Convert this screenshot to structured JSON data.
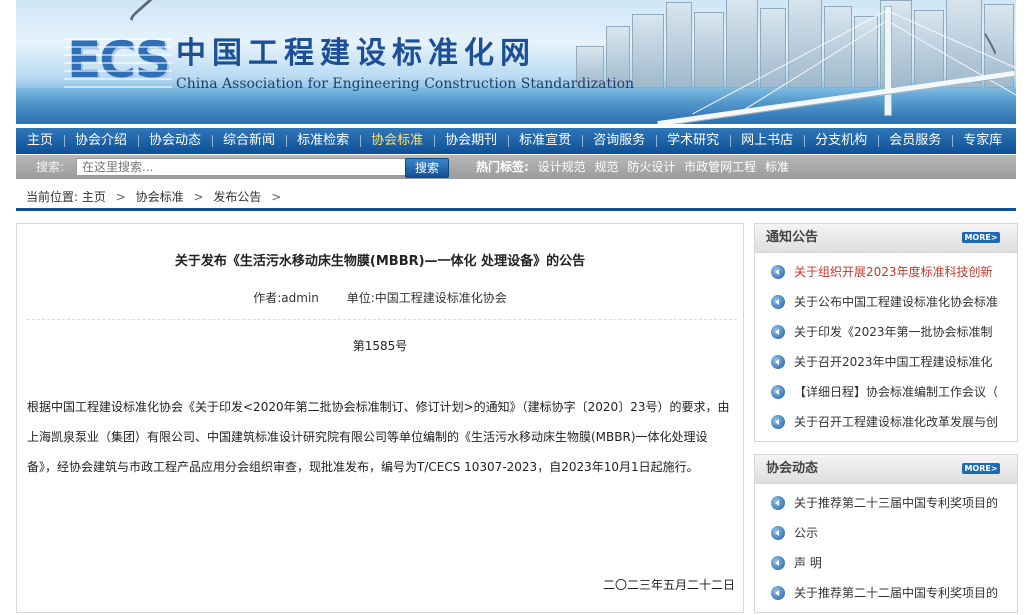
{
  "header": {
    "logo_letters": "ECS",
    "site_name_cn": "中国工程建设标准化网",
    "site_name_en": "China Association for Engineering Construction Standardization"
  },
  "nav": [
    {
      "label": "主页",
      "active": false
    },
    {
      "label": "协会介绍",
      "active": false
    },
    {
      "label": "协会动态",
      "active": false
    },
    {
      "label": "综合新闻",
      "active": false
    },
    {
      "label": "标准检索",
      "active": false
    },
    {
      "label": "协会标准",
      "active": true
    },
    {
      "label": "协会期刊",
      "active": false
    },
    {
      "label": "标准宣贯",
      "active": false
    },
    {
      "label": "咨询服务",
      "active": false
    },
    {
      "label": "学术研究",
      "active": false
    },
    {
      "label": "网上书店",
      "active": false
    },
    {
      "label": "分支机构",
      "active": false
    },
    {
      "label": "会员服务",
      "active": false
    },
    {
      "label": "专家库",
      "active": false
    }
  ],
  "search": {
    "label": "搜索:",
    "placeholder": "在这里搜索...",
    "button": "搜索",
    "hot_label": "热门标签:",
    "hot_tags": [
      "设计规范",
      "规范",
      "防火设计",
      "市政管网工程",
      "标准"
    ]
  },
  "breadcrumb": {
    "prefix": "当前位置:",
    "items": [
      "主页",
      "协会标准",
      "发布公告"
    ],
    "separator": ">"
  },
  "article": {
    "title": "关于发布《生活污水移动床生物膜(MBBR)—一体化 处理设备》的公告",
    "author": "作者:admin",
    "unit": "单位:中国工程建设标准化协会",
    "number": "第1585号",
    "body": "根据中国工程建设标准化协会《关于印发<2020年第二批协会标准制订、修订计划>的通知》（建标协字〔2020〕23号）的要求，由上海凯泉泵业（集团）有限公司、中国建筑标准设计研究院有限公司等单位编制的《生活污水移动床生物膜(MBBR)一体化处理设备》，经协会建筑与市政工程产品应用分会组织审查，现批准发布，编号为T/CECS 10307-2023，自2023年10月1日起施行。",
    "date": "二〇二三年五月二十二日"
  },
  "sidebar": {
    "notices": {
      "title": "通知公告",
      "more": "MORE>",
      "items": [
        {
          "text": "关于组织开展2023年度标准科技创新",
          "highlight": true
        },
        {
          "text": "关于公布中国工程建设标准化协会标准",
          "highlight": false
        },
        {
          "text": "关于印发《2023年第一批协会标准制",
          "highlight": false
        },
        {
          "text": "关于召开2023年中国工程建设标准化",
          "highlight": false
        },
        {
          "text": "【详细日程】协会标准编制工作会议（",
          "highlight": false
        },
        {
          "text": "关于召开工程建设标准化改革发展与创",
          "highlight": false
        }
      ]
    },
    "news": {
      "title": "协会动态",
      "more": "MORE>",
      "items": [
        {
          "text": "关于推荐第二十三届中国专利奖项目的",
          "highlight": false
        },
        {
          "text": "公示",
          "highlight": false
        },
        {
          "text": "声 明",
          "highlight": false
        },
        {
          "text": "关于推荐第二十二届中国专利奖项目的",
          "highlight": false
        }
      ]
    }
  }
}
